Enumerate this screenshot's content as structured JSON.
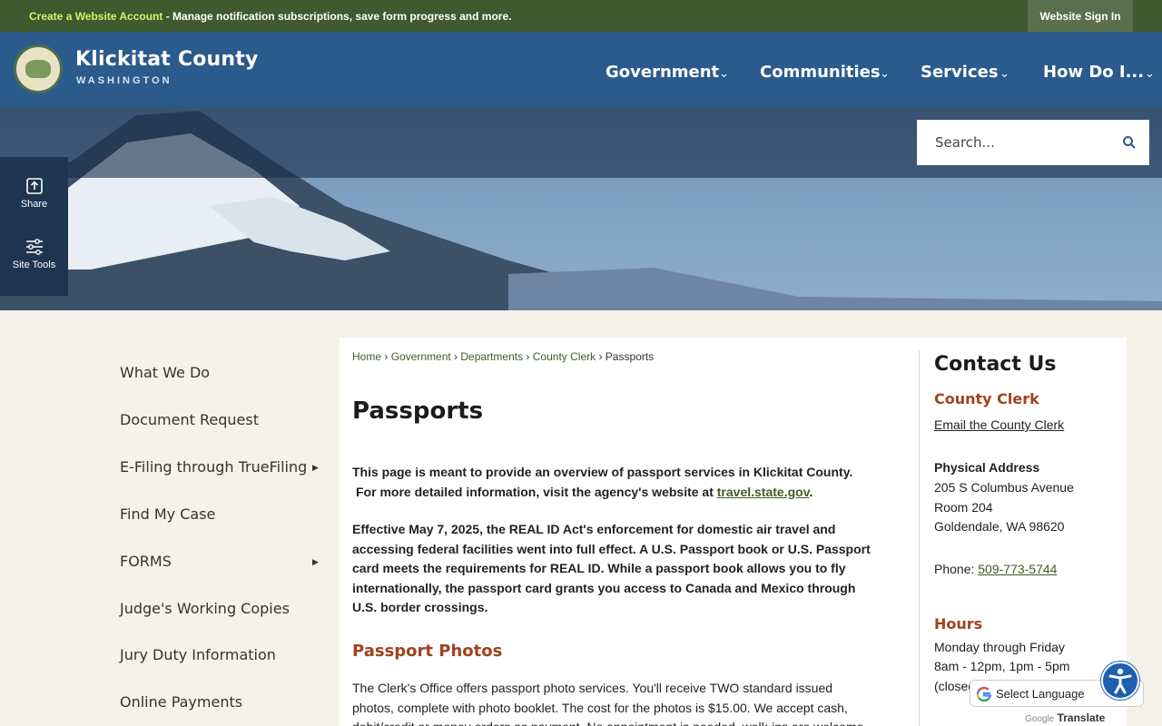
{
  "topbar": {
    "create_account": "Create a Website Account",
    "message": " - Manage notification subscriptions, save form progress and more.",
    "sign_in": "Website Sign In"
  },
  "header": {
    "name": "Klickitat County",
    "state": "WASHINGTON",
    "nav": [
      "Government",
      "Communities",
      "Services",
      "How Do I..."
    ]
  },
  "search": {
    "placeholder": "Search..."
  },
  "side_tools": {
    "share": "Share",
    "site_tools": "Site Tools"
  },
  "left_nav": [
    {
      "label": "What We Do",
      "has_submenu": false
    },
    {
      "label": "Document Request",
      "has_submenu": false
    },
    {
      "label": "E-Filing through TrueFiling",
      "has_submenu": true
    },
    {
      "label": "Find My Case",
      "has_submenu": false
    },
    {
      "label": "FORMS",
      "has_submenu": true
    },
    {
      "label": "Judge's Working Copies",
      "has_submenu": false
    },
    {
      "label": "Jury Duty Information",
      "has_submenu": false
    },
    {
      "label": "Online Payments",
      "has_submenu": false
    }
  ],
  "breadcrumb": [
    "Home",
    "Government",
    "Departments",
    "County Clerk",
    "Passports"
  ],
  "page": {
    "title": "Passports",
    "intro_1": "This page is meant to provide an overview of passport services in Klickitat County.",
    "intro_2a": "For more detailed information, visit the agency's website at ",
    "intro_link": "travel.state.gov",
    "intro_2b": ".",
    "realid_1": "Effective May 7, 2025, the REAL ID Act's enforcement for domestic air travel and",
    "realid_2": "accessing federal facilities went into full effect.  A U.S. Passport book or U.S. Passport",
    "realid_3": "card meets the requirements for REAL ID.  While a passport book allows you to fly",
    "realid_4": "internationally, the passport card grants you access to Canada and Mexico through",
    "realid_5": "U.S. border crossings.",
    "photos_heading": "Passport Photos",
    "photos_1": "The Clerk's Office offers passport photo services.  You'll receive TWO standard issued",
    "photos_2": "photos, complete with photo booklet.  The cost for the photos is $15.00.  We accept cash,",
    "photos_3": "debit/credit or money orders as payment.  No appointment is needed, walk-ins are welcome."
  },
  "contact": {
    "heading": "Contact Us",
    "dept": "County Clerk",
    "email_link": "Email the County Clerk",
    "addr_label": "Physical Address",
    "addr_1": "205 S Columbus Avenue",
    "addr_2": "Room 204",
    "addr_3": "Goldendale, WA 98620",
    "phone_label": "Phone: ",
    "phone": "509-773-5744",
    "hours_heading": "Hours",
    "hours_1": "Monday through Friday",
    "hours_2": "8am - 12pm, 1pm - 5pm",
    "hours_3": "(closed"
  },
  "translate": {
    "select": "Select Language",
    "google": "Google",
    "translate": "Translate"
  },
  "colors": {
    "topbar": "#3f5a2f",
    "header": "#2b5a8c",
    "accent": "#a0421d",
    "link": "#3d5e22"
  }
}
